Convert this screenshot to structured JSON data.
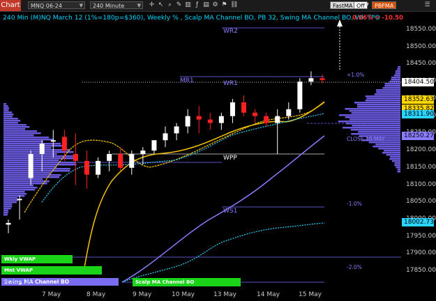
{
  "toolbar": {
    "chart_label": "Chart",
    "instrument": "MNQ 06-24",
    "interval": "240 Minute",
    "fastma_label": "FastMA",
    "off_label": "Off",
    "pbfma_label": "PBFMA"
  },
  "header": {
    "title": "240 Min (M)NQ March 12 (1%=180p=$360), Weekly % , Scalp MA Channel BO, PB 32, Swing MA Channel BO, Wk TPO",
    "change": "0.06% = -10.50"
  },
  "price_axis": {
    "ticks": [
      "18550.00",
      "18500.00",
      "18450.00",
      "18400.00",
      "18350.00",
      "18300.00",
      "18250.00",
      "18200.00",
      "18150.00",
      "18100.00",
      "18050.00",
      "18000.00",
      "17950.00",
      "17900.00",
      "17850.00"
    ]
  },
  "price_tags": [
    {
      "label": "18404.50",
      "bg": "#ffffff"
    },
    {
      "label": "18352.63",
      "bg": "#ffd700"
    },
    {
      "label": "18335.82",
      "bg": "#ffd700"
    },
    {
      "label": "18311.90",
      "bg": "#2ad4ff"
    },
    {
      "label": "18250.27",
      "bg": "#8a7cff"
    },
    {
      "label": "18002.73",
      "bg": "#2ad4ff"
    }
  ],
  "date_axis": [
    "7 May",
    "8 May",
    "9 May",
    "10 May",
    "13 May",
    "14 May",
    "15 May"
  ],
  "levels": {
    "wr2": "WR2",
    "mr1": "MR1",
    "wr1": "WR1",
    "wpp": "WPP",
    "ws1": "WS1",
    "close": "CLOSE 10 MAY",
    "plus1": "+1.0%",
    "minus1": "-1.0%",
    "minus2": "-2.0%"
  },
  "bottom_labels": {
    "wkly_vwap": "Wkly VWAP",
    "mnt_vwap": "Mnt VWAP",
    "swing": "Swing MA Channel BO",
    "scalp": "Scalp MA Channel BO",
    "watermark": "©2024 Ni"
  },
  "colors": {
    "accent": "#00d6ff",
    "up": "#ffffff",
    "down": "#ff2020",
    "ma_yellow": "#f5c400",
    "ma_violet": "#8a7cff",
    "vwap_cyan": "#2ad4ff",
    "green_label": "#19d419"
  },
  "chart_data": {
    "type": "candlestick",
    "x": [
      "7 May",
      "8 May",
      "9 May",
      "10 May",
      "13 May",
      "14 May",
      "15 May"
    ],
    "ylim": [
      17820,
      18590
    ],
    "last_price": 18404.5,
    "candles": [
      {
        "o": 17985,
        "h": 18000,
        "l": 17960,
        "c": 17990
      },
      {
        "o": 18060,
        "h": 18070,
        "l": 18000,
        "c": 18060
      },
      {
        "o": 18120,
        "h": 18200,
        "l": 18100,
        "c": 18190
      },
      {
        "o": 18190,
        "h": 18230,
        "l": 18140,
        "c": 18220
      },
      {
        "o": 18230,
        "h": 18260,
        "l": 18180,
        "c": 18230
      },
      {
        "o": 18240,
        "h": 18260,
        "l": 18170,
        "c": 18200
      },
      {
        "o": 18190,
        "h": 18250,
        "l": 18100,
        "c": 18170
      },
      {
        "o": 18170,
        "h": 18200,
        "l": 18090,
        "c": 18130
      },
      {
        "o": 18130,
        "h": 18180,
        "l": 18120,
        "c": 18170
      },
      {
        "o": 18170,
        "h": 18200,
        "l": 18140,
        "c": 18190
      },
      {
        "o": 18190,
        "h": 18210,
        "l": 18140,
        "c": 18150
      },
      {
        "o": 18150,
        "h": 18200,
        "l": 18130,
        "c": 18190
      },
      {
        "o": 18190,
        "h": 18210,
        "l": 18160,
        "c": 18200
      },
      {
        "o": 18200,
        "h": 18230,
        "l": 18190,
        "c": 18230
      },
      {
        "o": 18230,
        "h": 18270,
        "l": 18210,
        "c": 18250
      },
      {
        "o": 18250,
        "h": 18280,
        "l": 18230,
        "c": 18270
      },
      {
        "o": 18270,
        "h": 18320,
        "l": 18250,
        "c": 18300
      },
      {
        "o": 18300,
        "h": 18330,
        "l": 18250,
        "c": 18290
      },
      {
        "o": 18290,
        "h": 18310,
        "l": 18260,
        "c": 18280
      },
      {
        "o": 18280,
        "h": 18310,
        "l": 18260,
        "c": 18300
      },
      {
        "o": 18300,
        "h": 18350,
        "l": 18280,
        "c": 18340
      },
      {
        "o": 18340,
        "h": 18360,
        "l": 18300,
        "c": 18310
      },
      {
        "o": 18310,
        "h": 18320,
        "l": 18280,
        "c": 18300
      },
      {
        "o": 18300,
        "h": 18310,
        "l": 18270,
        "c": 18280
      },
      {
        "o": 18280,
        "h": 18320,
        "l": 18190,
        "c": 18300
      },
      {
        "o": 18300,
        "h": 18340,
        "l": 18290,
        "c": 18320
      },
      {
        "o": 18320,
        "h": 18410,
        "l": 18310,
        "c": 18400
      },
      {
        "o": 18400,
        "h": 18430,
        "l": 18390,
        "c": 18410
      },
      {
        "o": 18410,
        "h": 18420,
        "l": 18395,
        "c": 18404.5
      }
    ],
    "levels": {
      "WR2": 18555,
      "MR1": 18410,
      "WR1": 18400,
      "WPP": 18200,
      "WS1": 18045,
      "CLOSE 10 MAY": 18280
    },
    "pct_levels": {
      "+1.0%": 18420,
      "-1.0%": 18055,
      "-2.0%": 17870
    }
  }
}
